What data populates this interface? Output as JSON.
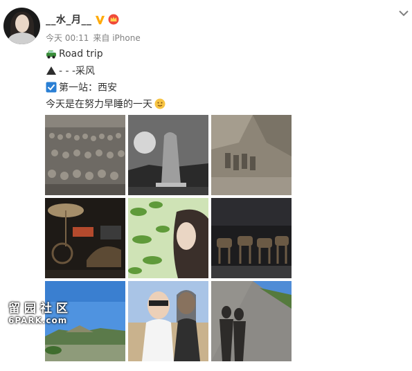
{
  "post": {
    "author": "__水_月__",
    "time": "今天 00:11",
    "source": "来自 iPhone",
    "lines": [
      {
        "icon": "car-emoji",
        "text": "Road trip"
      },
      {
        "icon": "mountain-emoji",
        "text": "- - -采风"
      },
      {
        "icon": "checkbox-emoji",
        "text": "第一站：西安"
      },
      {
        "icon": "smile-emoji",
        "text": "今天是在努力早睡的一天"
      }
    ],
    "images": [
      "terracotta-pit-image",
      "stone-monument-image",
      "terracotta-excavation-image",
      "bronze-chariot-image",
      "selfie-leaves-image",
      "horse-chariot-museum-image",
      "landscape-mound-image",
      "two-friends-selfie-image",
      "shadows-path-image"
    ]
  },
  "watermark": {
    "cn": "留园社区",
    "en": "6PARK.com"
  },
  "colors": {
    "name": "#333333",
    "meta": "#808080",
    "verified": "#ffab0b"
  }
}
